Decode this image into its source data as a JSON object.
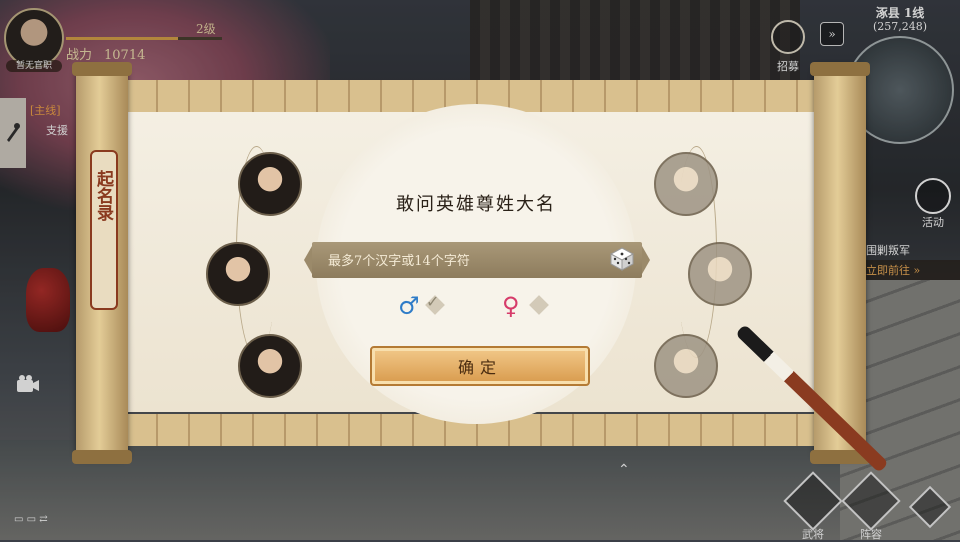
{
  "player": {
    "title": "暂无官职",
    "level": "2级",
    "level_progress": 0.72,
    "power_label": "战力",
    "power_value": "10714"
  },
  "quest": {
    "tag": "[主线]",
    "text": "支援"
  },
  "hud_right": {
    "recruit_label": "招募",
    "zone": "涿县 1线",
    "coordinates": "(257,248)",
    "activity_label": "活动",
    "event_title": "围剿叛军",
    "event_action": "立即前往 »"
  },
  "bottom_buttons": [
    {
      "label": "武将"
    },
    {
      "label": "阵容"
    }
  ],
  "dialog": {
    "side_title": "起名录",
    "prompt": "敢问英雄尊姓大名",
    "name_placeholder": "最多7个汉字或14个字符",
    "male_symbol": "♂",
    "female_symbol": "♀",
    "confirm_label": "确定",
    "male_color": "#2f7cc8",
    "female_color": "#d63b6a"
  },
  "icons": [
    "dice-icon",
    "camera-icon",
    "quest-icon",
    "check-icon",
    "recruit-icon",
    "activity-icon",
    "generals-icon",
    "formation-icon"
  ]
}
